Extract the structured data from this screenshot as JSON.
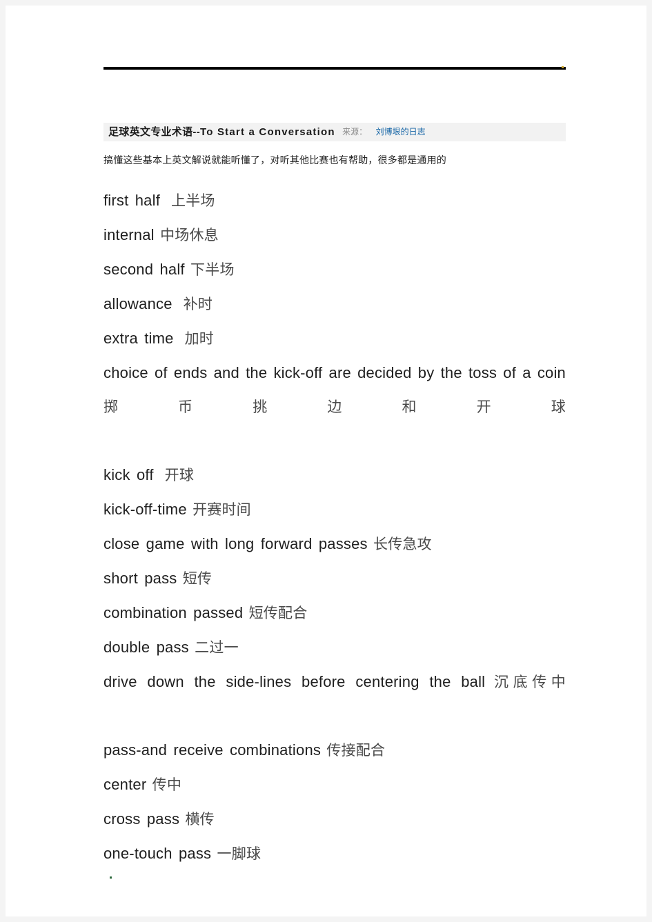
{
  "document": {
    "title_prefix_zh": "足球英文专业术语",
    "title_separator": "--",
    "title_en": "To Start a Conversation",
    "source_label": "来源：",
    "source_link": "刘博垠的日志",
    "subtitle": "搞懂这些基本上英文解说就能听懂了，对听其他比赛也有帮助，很多都是通用的",
    "accent_link_color": "#1464a5",
    "band_bg_color": "#f2f2f2",
    "page_bg_color": "#ffffff",
    "canvas_bg_color": "#f4f4f4",
    "top_dot_color": "#c9a227",
    "bottom_dot_color": "#2e6b3e"
  },
  "terms": [
    {
      "en": "first  half",
      "zh": "上半场",
      "wide_gap": true
    },
    {
      "en": "internal",
      "zh": "中场休息",
      "wide_gap": false
    },
    {
      "en": "second  half",
      "zh": "下半场",
      "wide_gap": false
    },
    {
      "en": "allowance",
      "zh": "补时",
      "wide_gap": true
    },
    {
      "en": "extra  time",
      "zh": "加时",
      "wide_gap": true
    },
    {
      "en": "choice of ends and the kick-off are decided by the toss of a coin",
      "zh": "掷币挑边和开球",
      "wide_gap": false,
      "multiline": true
    },
    {
      "en": "kick  off",
      "zh": "开球",
      "wide_gap": true
    },
    {
      "en": "kick-off-time",
      "zh": "开赛时间",
      "wide_gap": false
    },
    {
      "en": "close  game  with  long  forward  passes",
      "zh": "长传急攻",
      "wide_gap": false
    },
    {
      "en": "short  pass",
      "zh": "短传",
      "wide_gap": false
    },
    {
      "en": "combination  passed",
      "zh": "短传配合",
      "wide_gap": false
    },
    {
      "en": "double  pass",
      "zh": "二过一",
      "wide_gap": false
    },
    {
      "en": "drive down the side-lines before centering the ball",
      "zh": "沉底传中",
      "wide_gap": false,
      "multiline": true
    },
    {
      "en": "pass-and  receive  combinations",
      "zh": "传接配合",
      "wide_gap": false
    },
    {
      "en": "center",
      "zh": "传中",
      "wide_gap": false
    },
    {
      "en": "cross  pass",
      "zh": "横传",
      "wide_gap": false
    },
    {
      "en": "one-touch  pass",
      "zh": "一脚球",
      "wide_gap": false
    }
  ]
}
